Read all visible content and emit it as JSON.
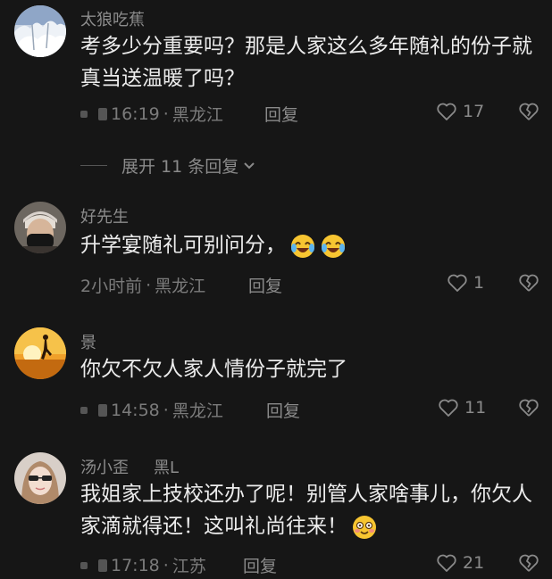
{
  "comments": [
    {
      "name": "太狼吃蕉",
      "text": "考多少分重要吗？那是人家这么多年随礼的份子就真当送温暖了吗？",
      "time": "16:19",
      "location": "黑龙江",
      "reply": "回复",
      "likes": "17"
    },
    {
      "name": "好先生",
      "text": "升学宴随礼可别问分，",
      "time": "2小时前",
      "location": "黑龙江",
      "reply": "回复",
      "likes": "1"
    },
    {
      "name": "景",
      "text": "你欠不欠人家人情份子就完了",
      "time": "14:58",
      "location": "黑龙江",
      "reply": "回复",
      "likes": "11"
    },
    {
      "name": "汤小歪",
      "tag": "黑L",
      "text": "我姐家上技校还办了呢！别管人家啥事儿，你欠人家滴就得还！这叫礼尚往来！",
      "time": "17:18",
      "location": "江苏",
      "reply": "回复",
      "likes": "21"
    }
  ],
  "expand": {
    "label": "展开 11 条回复"
  },
  "separator": "·",
  "icons": {
    "like": "heart-outline-icon",
    "dislike": "broken-heart-icon",
    "expand": "chevron-down-icon",
    "laugh": "laughing-tears-emoji",
    "smile": "blushing-smile-emoji"
  }
}
